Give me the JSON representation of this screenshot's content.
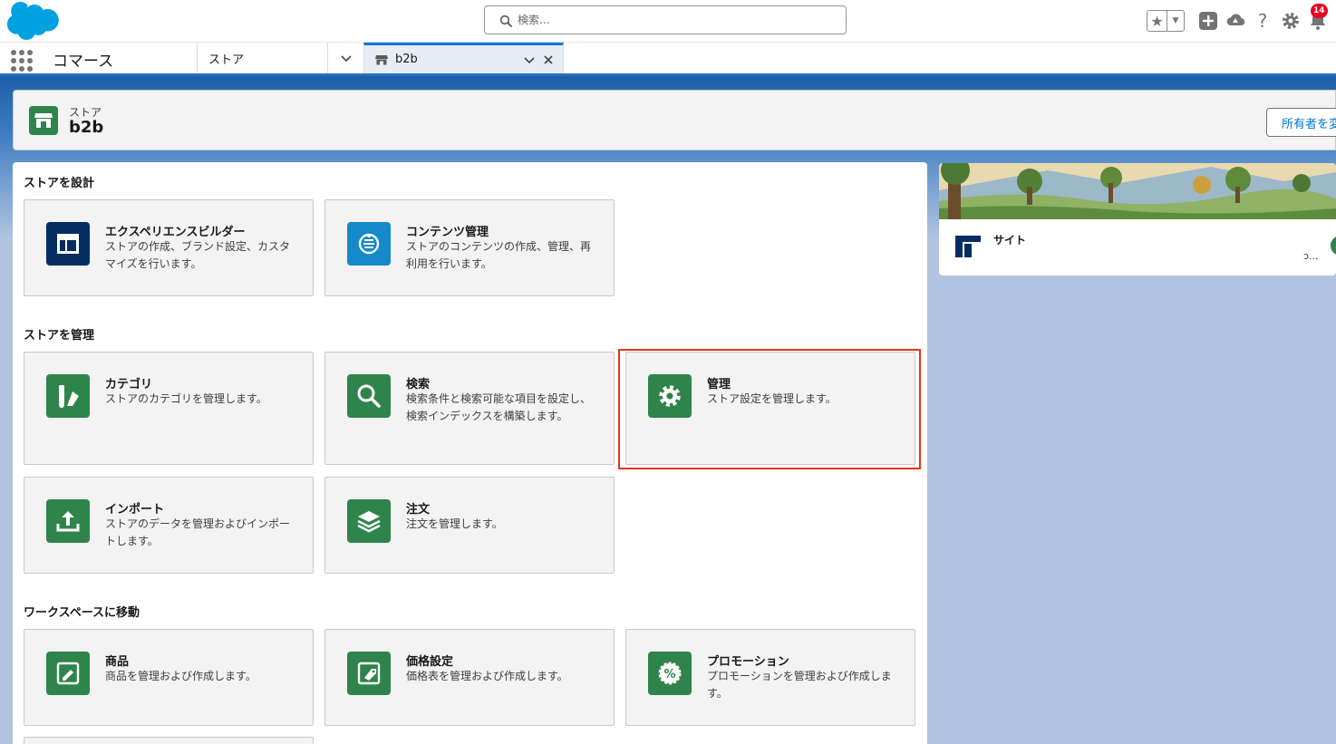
{
  "header": {
    "search_placeholder": "検索...",
    "notification_count": "14"
  },
  "nav": {
    "app_name": "コマース",
    "store_tab": "ストア",
    "active_tab": "b2b"
  },
  "record": {
    "type_label": "ストア",
    "title": "b2b",
    "change_owner_label": "所有者を変"
  },
  "sections": {
    "design": "ストアを設計",
    "manage": "ストアを管理",
    "workspace": "ワークスペースに移動"
  },
  "tiles": {
    "experience_builder": {
      "title": "エクスペリエンスビルダー",
      "desc": "ストアの作成、ブランド設定、カスタマイズを行います。"
    },
    "content": {
      "title": "コンテンツ管理",
      "desc": "ストアのコンテンツの作成、管理、再利用を行います。"
    },
    "category": {
      "title": "カテゴリ",
      "desc": "ストアのカテゴリを管理します。"
    },
    "search": {
      "title": "検索",
      "desc": "検索条件と検索可能な項目を設定し、検索インデックスを構築します。"
    },
    "admin": {
      "title": "管理",
      "desc": "ストア設定を管理します。"
    },
    "import": {
      "title": "インポート",
      "desc": "ストアのデータを管理およびインポートします。"
    },
    "orders": {
      "title": "注文",
      "desc": "注文を管理します。"
    },
    "products": {
      "title": "商品",
      "desc": "商品を管理および作成します。"
    },
    "pricing": {
      "title": "価格設定",
      "desc": "価格表を管理および作成します。"
    },
    "promotions": {
      "title": "プロモーション",
      "desc": "プロモーションを管理および作成します。"
    }
  },
  "side": {
    "site_label": "サイト",
    "truncated": "ɔ..."
  },
  "colors": {
    "brand_blue": "#0176d3",
    "tile_navy": "#032d60",
    "tile_blue": "#1589c9",
    "tile_green": "#2e844a",
    "highlight_red": "#e0361e"
  }
}
